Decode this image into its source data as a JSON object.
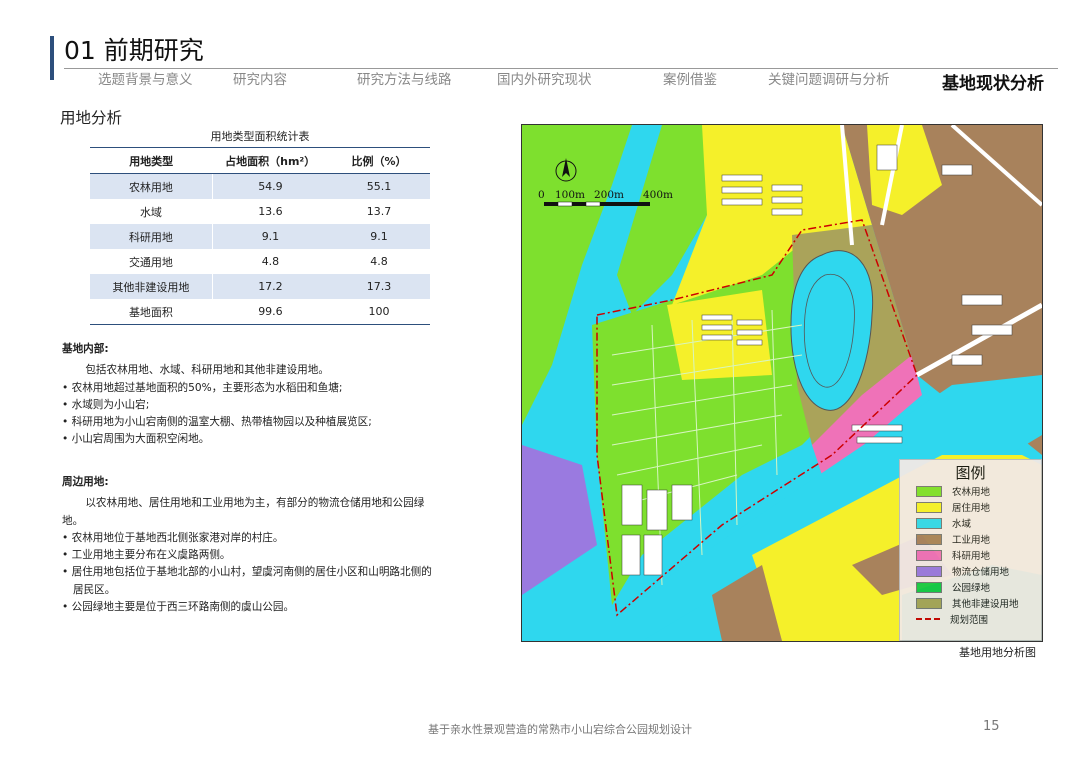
{
  "header": {
    "title": "01 前期研究",
    "tabs": [
      {
        "label": "选题背景与意义"
      },
      {
        "label": "研究内容"
      },
      {
        "label": "研究方法与线路"
      },
      {
        "label": "国内外研究现状"
      },
      {
        "label": "案例借鉴"
      },
      {
        "label": "关键问题调研与分析"
      },
      {
        "label": "基地现状分析"
      }
    ]
  },
  "section": {
    "title": "用地分析"
  },
  "table": {
    "caption": "用地类型面积统计表",
    "headers": [
      "用地类型",
      "占地面积（hm²）",
      "比例（%）"
    ],
    "rows": [
      [
        "农林用地",
        "54.9",
        "55.1"
      ],
      [
        "水域",
        "13.6",
        "13.7"
      ],
      [
        "科研用地",
        "9.1",
        "9.1"
      ],
      [
        "交通用地",
        "4.8",
        "4.8"
      ],
      [
        "其他非建设用地",
        "17.2",
        "17.3"
      ],
      [
        "基地面积",
        "99.6",
        "100"
      ]
    ]
  },
  "internal": {
    "heading": "基地内部:",
    "intro": "包括农林用地、水域、科研用地和其他非建设用地。",
    "bullets": [
      "• 农林用地超过基地面积的50%，主要形态为水稻田和鱼塘;",
      "• 水域则为小山宕;",
      "• 科研用地为小山宕南侧的温室大棚、热带植物园以及种植展览区;",
      "• 小山宕周围为大面积空闲地。"
    ]
  },
  "surrounding": {
    "heading": "周边用地:",
    "intro": "以农林用地、居住用地和工业用地为主，有部分的物流仓储用地和公园绿地。",
    "bullets": [
      "• 农林用地位于基地西北侧张家港对岸的村庄。",
      "• 工业用地主要分布在义虞路两侧。",
      "• 居住用地包括位于基地北部的小山村，望虞河南侧的居住小区和山明路北侧的居民区。",
      "• 公园绿地主要是位于西三环路南侧的虞山公园。"
    ]
  },
  "map": {
    "scale_labels": [
      "0",
      "100m",
      "200m",
      "400m"
    ],
    "north_label": "N",
    "caption": "基地用地分析图"
  },
  "legend": {
    "title": "图例",
    "items": [
      {
        "label": "农林用地",
        "color": "#7ee02e"
      },
      {
        "label": "居住用地",
        "color": "#f5f02a"
      },
      {
        "label": "水域",
        "color": "#2fd7ee"
      },
      {
        "label": "工业用地",
        "color": "#a8825c"
      },
      {
        "label": "科研用地",
        "color": "#ef72b8"
      },
      {
        "label": "物流仓储用地",
        "color": "#9a7ae0"
      },
      {
        "label": "公园绿地",
        "color": "#18c846"
      },
      {
        "label": "其他非建设用地",
        "color": "#aaa35a"
      },
      {
        "label": "规划范围",
        "color": "#cc0000"
      }
    ]
  },
  "footer": {
    "text": "基于亲水性景观营造的常熟市小山宕综合公园规划设计",
    "page": "15"
  }
}
